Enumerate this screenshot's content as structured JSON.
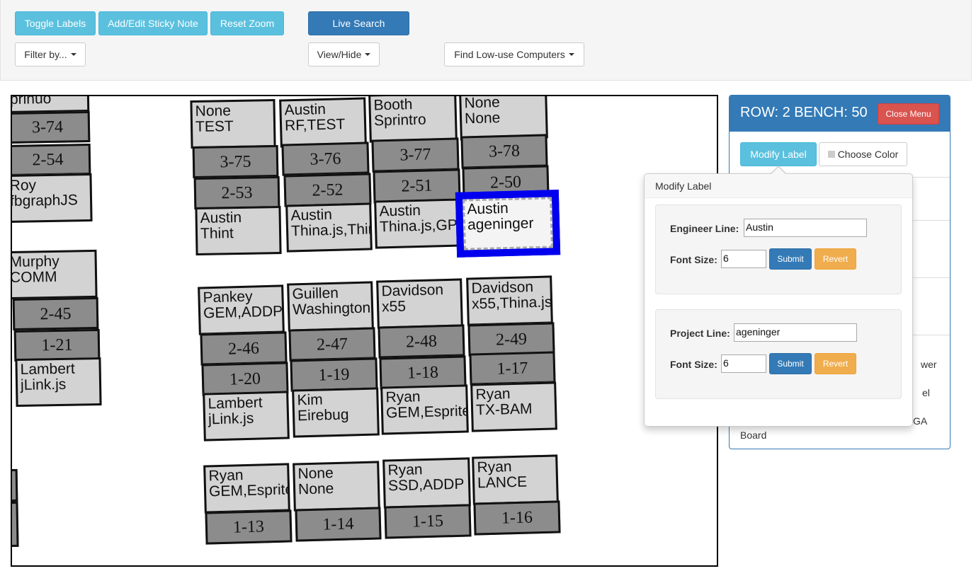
{
  "toolbar": {
    "toggle_labels": "Toggle Labels",
    "sticky_note": "Add/Edit Sticky Note",
    "reset_zoom": "Reset Zoom",
    "live_search": "Live Search",
    "filter_by": "Filter by...",
    "view_hide": "View/Hide",
    "find_low_use": "Find Low-use Computers"
  },
  "map": {
    "benches": [
      {
        "id": "a1",
        "lines": [
          "prinuo"
        ]
      },
      {
        "id": "a2",
        "lines": [
          "3-74"
        ]
      },
      {
        "id": "a3",
        "lines": [
          "2-54"
        ]
      },
      {
        "id": "a4",
        "lines": [
          "Roy",
          "fbgraphJS"
        ]
      },
      {
        "id": "b1",
        "lines": [
          "None",
          "TEST"
        ]
      },
      {
        "id": "b2",
        "lines": [
          "3-75"
        ]
      },
      {
        "id": "b3",
        "lines": [
          "2-53"
        ]
      },
      {
        "id": "b4",
        "lines": [
          "Austin",
          "Thint"
        ]
      },
      {
        "id": "c1",
        "lines": [
          "Austin",
          "RF,TEST"
        ]
      },
      {
        "id": "c2",
        "lines": [
          "3-76"
        ]
      },
      {
        "id": "c3",
        "lines": [
          "2-52"
        ]
      },
      {
        "id": "c4",
        "lines": [
          "Austin",
          "Thina.js,Thint"
        ]
      },
      {
        "id": "d1",
        "lines": [
          "Booth",
          "Sprintro"
        ]
      },
      {
        "id": "d2",
        "lines": [
          "3-77"
        ]
      },
      {
        "id": "d3",
        "lines": [
          "2-51"
        ]
      },
      {
        "id": "d4",
        "lines": [
          "Austin",
          "Thina.js,GPS"
        ]
      },
      {
        "id": "e1",
        "lines": [
          "None",
          "None"
        ]
      },
      {
        "id": "e2",
        "lines": [
          "3-78"
        ]
      },
      {
        "id": "e3",
        "lines": [
          "2-50"
        ]
      },
      {
        "id": "e4",
        "lines": [
          "Austin",
          "ageninger"
        ]
      },
      {
        "id": "f1",
        "lines": [
          "Murphy",
          "COMM"
        ]
      },
      {
        "id": "f2",
        "lines": [
          "2-45"
        ]
      },
      {
        "id": "f3",
        "lines": [
          "1-21"
        ]
      },
      {
        "id": "f4",
        "lines": [
          "Lambert",
          "jLink.js"
        ]
      },
      {
        "id": "g1",
        "lines": [
          "Pankey",
          "GEM,ADDP"
        ]
      },
      {
        "id": "g2",
        "lines": [
          "2-46"
        ]
      },
      {
        "id": "g3",
        "lines": [
          "1-20"
        ]
      },
      {
        "id": "g4",
        "lines": [
          "Lambert",
          "jLink.js"
        ]
      },
      {
        "id": "h1",
        "lines": [
          "Guillen",
          "Washington"
        ]
      },
      {
        "id": "h2",
        "lines": [
          "2-47"
        ]
      },
      {
        "id": "h3",
        "lines": [
          "1-19"
        ]
      },
      {
        "id": "h4",
        "lines": [
          "Kim",
          "Eirebug"
        ]
      },
      {
        "id": "i1",
        "lines": [
          "Davidson",
          "x55"
        ]
      },
      {
        "id": "i2",
        "lines": [
          "2-48"
        ]
      },
      {
        "id": "i3",
        "lines": [
          "1-18"
        ]
      },
      {
        "id": "i4",
        "lines": [
          "Ryan",
          "GEM,Esprite"
        ]
      },
      {
        "id": "j1",
        "lines": [
          "Davidson",
          "x55,Thina.js"
        ]
      },
      {
        "id": "j2",
        "lines": [
          "2-49"
        ]
      },
      {
        "id": "j3",
        "lines": [
          "1-17"
        ]
      },
      {
        "id": "j4",
        "lines": [
          "Ryan",
          "TX-BAM"
        ]
      },
      {
        "id": "k1",
        "lines": [
          "Ryan",
          "GEM,Esprite"
        ]
      },
      {
        "id": "k2",
        "lines": [
          "1-13"
        ]
      },
      {
        "id": "l1",
        "lines": [
          "None",
          "None"
        ]
      },
      {
        "id": "l2",
        "lines": [
          "1-14"
        ]
      },
      {
        "id": "m1",
        "lines": [
          "Ryan",
          "SSD,ADDP"
        ]
      },
      {
        "id": "m2",
        "lines": [
          "1-15"
        ]
      },
      {
        "id": "n1",
        "lines": [
          "Ryan",
          "LANCE"
        ]
      },
      {
        "id": "n2",
        "lines": [
          "1-16"
        ]
      }
    ]
  },
  "panel": {
    "title": "ROW: 2 BENCH: 50",
    "close_menu": "Close Menu",
    "modify_label": "Modify Label",
    "choose_color": "Choose Color",
    "partial_text_1": "wer",
    "partial_text_2": "el",
    "partial_text_3": "GA",
    "board": "Board"
  },
  "popover": {
    "title": "Modify Label",
    "engineer_label": "Engineer Line:",
    "engineer_value": "Austin",
    "engineer_font_label": "Font Size:",
    "engineer_font_value": "6",
    "project_label": "Project Line:",
    "project_value": "ageninger",
    "project_font_label": "Font Size:",
    "project_font_value": "6",
    "submit": "Submit",
    "revert": "Revert"
  },
  "colors": {
    "accent": "#337ab7",
    "info": "#5bc0de",
    "danger": "#d9534f",
    "warning": "#f0ad4e",
    "bench_label": "#d3d3d3",
    "bench_number": "#8c8c8c",
    "selected_bench": "#0000ee"
  }
}
